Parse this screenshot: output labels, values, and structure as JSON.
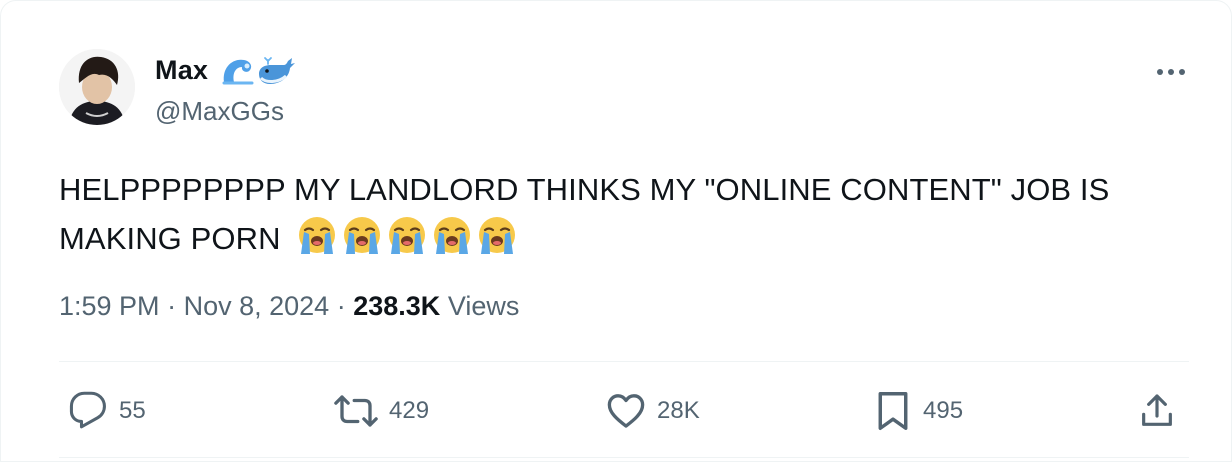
{
  "tweet": {
    "author": {
      "display_name": "Max",
      "handle": "@MaxGGs",
      "badge_icons": [
        "wave-emoji-icon",
        "whale-emoji-icon"
      ]
    },
    "text_line1": "HELPPPPPPPP MY LANDLORD THINKS MY \"ONLINE CONTENT\" JOB IS",
    "text_line2": "MAKING PORN",
    "emojis": [
      "loudly-crying-face",
      "loudly-crying-face",
      "loudly-crying-face",
      "loudly-crying-face",
      "loudly-crying-face"
    ],
    "time": "1:59 PM",
    "date": "Nov 8, 2024",
    "separator": "·",
    "views_count": "238.3K",
    "views_label": "Views"
  },
  "actions": {
    "replies": "55",
    "reposts": "429",
    "likes": "28K",
    "bookmarks": "495"
  },
  "colors": {
    "text": "#0f1419",
    "muted": "#536471",
    "divider": "#eff3f4",
    "emoji_face": "#f7c94a",
    "emoji_tears": "#5aa7e6"
  }
}
